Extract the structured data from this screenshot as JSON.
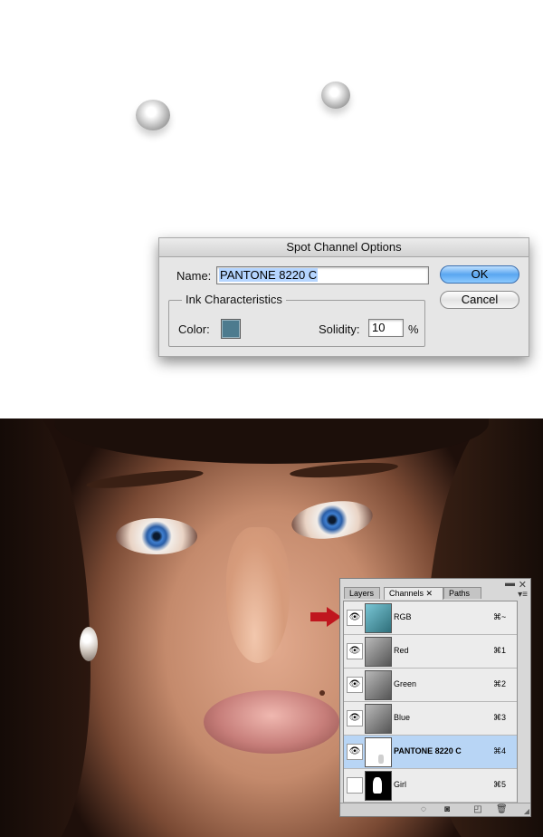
{
  "dialog": {
    "title": "Spot Channel Options",
    "name_label": "Name:",
    "name_value": "PANTONE 8220 C",
    "ok_label": "OK",
    "cancel_label": "Cancel",
    "ink_legend": "Ink Characteristics",
    "color_label": "Color:",
    "color_value": "#4d7b8e",
    "solidity_label": "Solidity:",
    "solidity_value": "10",
    "percent_label": "%"
  },
  "panel": {
    "tabs": [
      {
        "label": "Layers"
      },
      {
        "label": "Channels",
        "close": "✕"
      },
      {
        "label": "Paths"
      }
    ],
    "channels": [
      {
        "name": "RGB",
        "shortcut": "⌘~"
      },
      {
        "name": "Red",
        "shortcut": "⌘1"
      },
      {
        "name": "Green",
        "shortcut": "⌘2"
      },
      {
        "name": "Blue",
        "shortcut": "⌘3"
      },
      {
        "name": "PANTONE 8220 C",
        "shortcut": "⌘4"
      },
      {
        "name": "Girl",
        "shortcut": "⌘5"
      }
    ]
  },
  "colors": {
    "arrow": "#c0161e",
    "selected_row": "#b8d5f5",
    "ok_button": "#5aa6f0"
  }
}
